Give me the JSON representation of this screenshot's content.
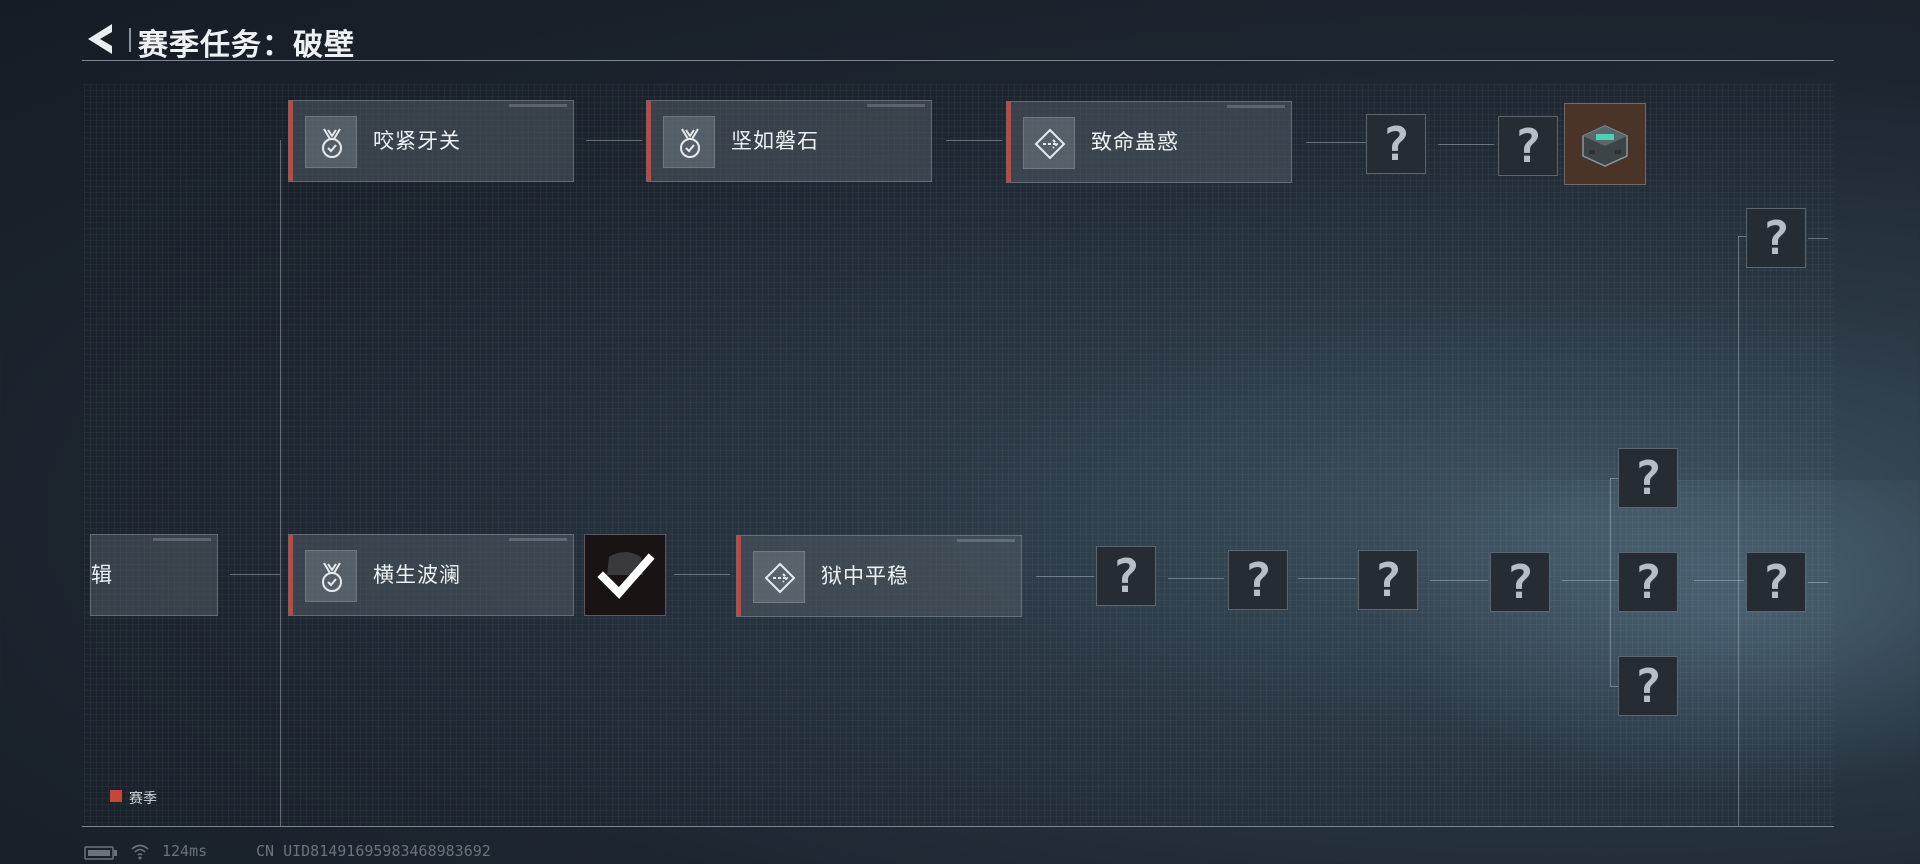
{
  "header": {
    "title": "赛季任务：破壁"
  },
  "tasks": {
    "row1": [
      "咬紧牙关",
      "坚如磐石",
      "致命蛊惑"
    ],
    "row2_partial": "辑",
    "row2": [
      "横生波澜",
      "狱中平稳"
    ]
  },
  "unknown_glyph": "?",
  "legend": {
    "label": "赛季",
    "color": "#c6463c"
  },
  "status": {
    "latency": "124ms",
    "uid": "CN UID8149169598346898369​2"
  },
  "icons": [
    "back-arrow-icon",
    "medal-icon",
    "diamond-sign-icon",
    "battery-icon",
    "wifi-icon",
    "reward-chest-icon",
    "checkmark-icon"
  ]
}
